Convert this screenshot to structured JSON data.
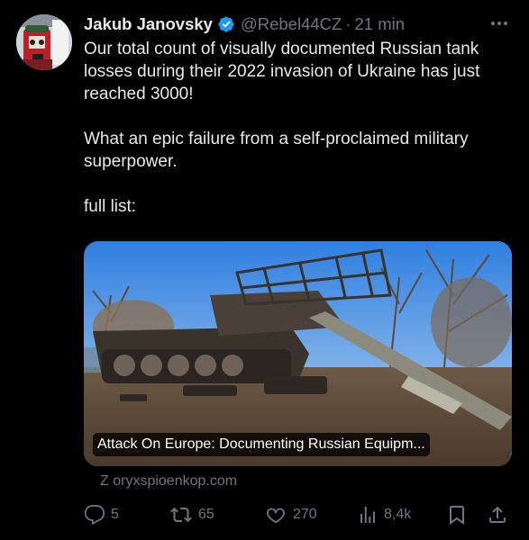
{
  "tweet": {
    "author_name": "Jakub Janovsky",
    "handle": "@Rebel44CZ",
    "separator": "·",
    "time": "21 min",
    "body": "Our total count of visually documented Russian tank losses during their 2022 invasion of Ukraine has just reached 3000!\n\nWhat an epic failure from a self-proclaimed military superpower.\n\nfull list:",
    "verified_color": "#1d9bf0",
    "more_icon": "more-icon"
  },
  "card": {
    "title": "Attack On Europe: Documenting Russian Equipm...",
    "domain_text": "Z oryxspioenkop.com",
    "image_description_icon": "destroyed-tank-photo"
  },
  "actions": {
    "replies": "5",
    "retweets": "65",
    "likes": "270",
    "views": "8,4k"
  },
  "colors": {
    "background": "#000000",
    "text": "#e7e9ea",
    "secondary": "#71767b",
    "accent": "#1d9bf0"
  }
}
